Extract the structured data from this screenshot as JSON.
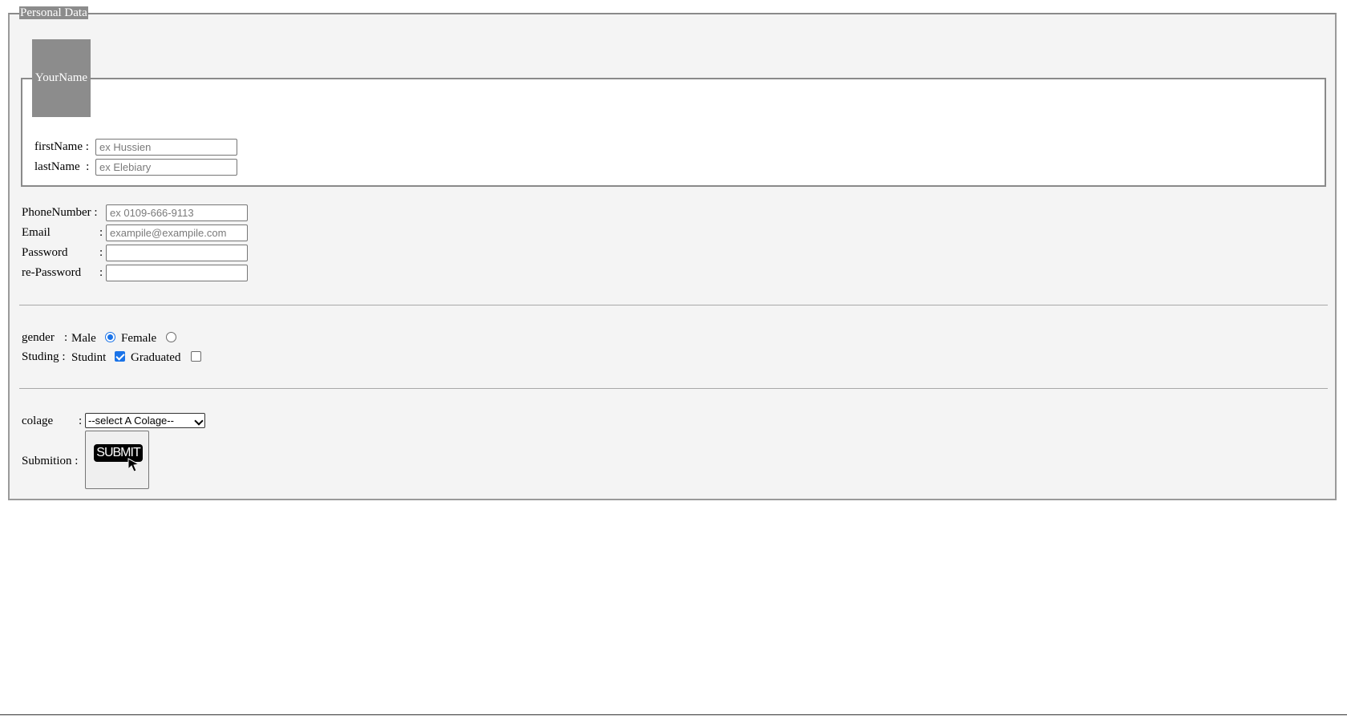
{
  "fieldsets": {
    "personal_legend": "Personal Data",
    "name_legend": "YourName"
  },
  "name": {
    "first_label": "firstName :",
    "first_placeholder": "ex Hussien",
    "last_label": "lastName  :",
    "last_placeholder": "ex Elebiary"
  },
  "contact": {
    "phone_label": "PhoneNumber :",
    "phone_placeholder": "ex 0109-666-9113",
    "email_label": "Email",
    "email_placeholder": "exampile@exampile.com",
    "password_label": "Password",
    "repassword_label": "re-Password",
    "colon": ":"
  },
  "gender": {
    "label": "gender",
    "colon": ":",
    "male_label": "Male",
    "female_label": "Female",
    "selected": "Male"
  },
  "studing": {
    "label": "Studing :",
    "studint_label": "Studint",
    "graduated_label": "Graduated",
    "studint_checked": true,
    "graduated_checked": false
  },
  "colage": {
    "label": "colage",
    "colon": ":",
    "selected_option": "--select A Colage--"
  },
  "submition": {
    "label": "Submition :",
    "button_icon_text": "SUBMIT"
  },
  "colors": {
    "legend_bg": "#8c8c8c",
    "form_bg": "#f4f4f4",
    "accent": "#1a73e8"
  }
}
